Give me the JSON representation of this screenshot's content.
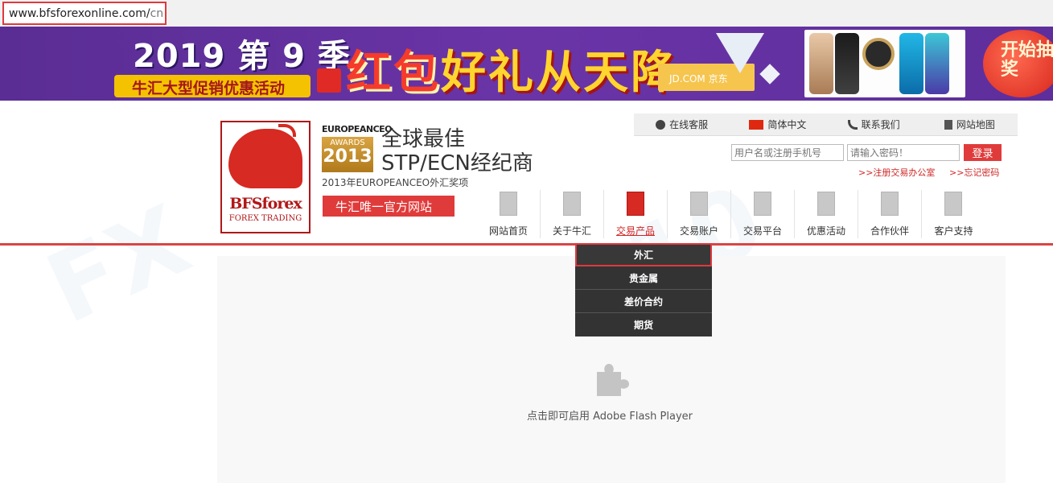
{
  "browser": {
    "url_main": "www.bfsforexonline.com/",
    "url_path": "cn"
  },
  "banner": {
    "season": "2019 第 9 季",
    "subtitle": "牛汇大型促销优惠活动",
    "headline_red": "红包",
    "headline_rest": "好礼从天降",
    "jd_label": "JD.COM 京东",
    "start_label": "开始抽奖"
  },
  "logo": {
    "name": "BFSforex",
    "tagline": "FOREX TRADING"
  },
  "award": {
    "header": "EUROPEANCEO",
    "title": "AWARDS",
    "year": "2013",
    "caption": "2013年EUROPEANCEO外汇奖项"
  },
  "slogan": {
    "line1": "全球最佳",
    "line2": "STP/ECN经纪商"
  },
  "official_label": "牛汇唯一官方网站",
  "top_links": [
    {
      "label": "在线客服",
      "icon": "chat-icon"
    },
    {
      "label": "简体中文",
      "icon": "china-flag-icon"
    },
    {
      "label": "联系我们",
      "icon": "phone-icon"
    },
    {
      "label": "网站地图",
      "icon": "sitemap-icon"
    }
  ],
  "login": {
    "username_placeholder": "用户名或注册手机号",
    "password_placeholder": "请输入密码！",
    "button": "登录",
    "register": ">>注册交易办公室",
    "forgot": ">>忘记密码"
  },
  "nav": [
    {
      "label": "网站首页"
    },
    {
      "label": "关于牛汇"
    },
    {
      "label": "交易产品",
      "active": true
    },
    {
      "label": "交易账户"
    },
    {
      "label": "交易平台"
    },
    {
      "label": "优惠活动"
    },
    {
      "label": "合作伙伴"
    },
    {
      "label": "客户支持"
    }
  ],
  "dropdown": [
    "外汇",
    "贵金属",
    "差价合约",
    "期货"
  ],
  "flash": {
    "text": "点击即可启用 Adobe Flash Player"
  },
  "colors": {
    "brand_red": "#e03b3b",
    "banner_purple": "#5a2d94",
    "highlight": "#e0393e"
  }
}
